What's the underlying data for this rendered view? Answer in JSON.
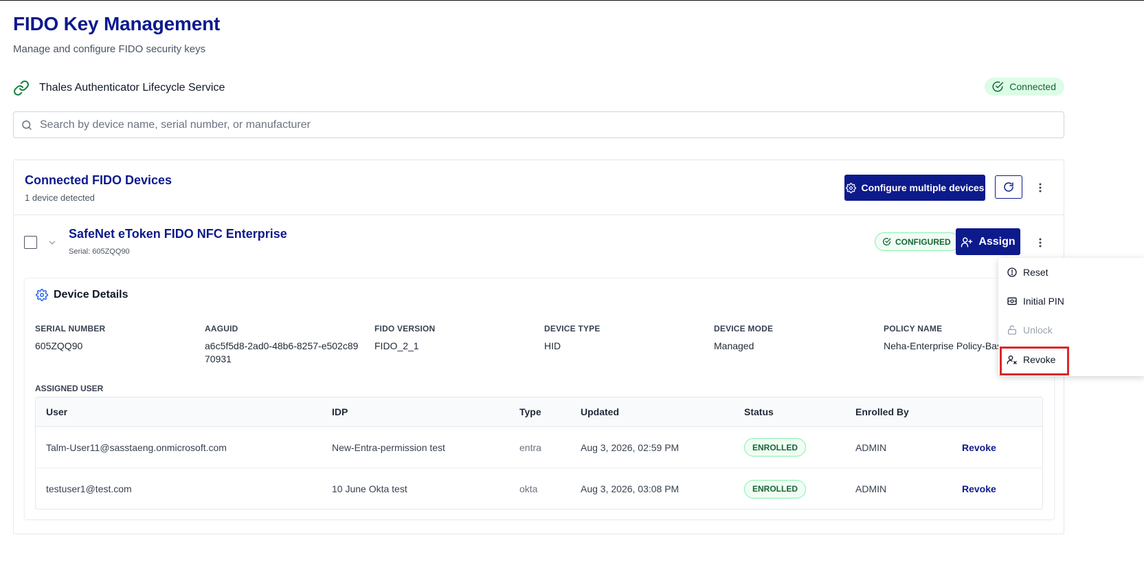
{
  "header": {
    "title": "FIDO Key Management",
    "subtitle": "Manage and configure FIDO security keys"
  },
  "service": {
    "name": "Thales Authenticator Lifecycle Service",
    "status": "Connected"
  },
  "search": {
    "placeholder": "Search by device name, serial number, or manufacturer",
    "value": ""
  },
  "devices_card": {
    "title": "Connected FIDO Devices",
    "count": "1 device detected",
    "configure_label": "Configure multiple devices"
  },
  "device": {
    "name": "SafeNet eToken FIDO NFC Enterprise",
    "serial": "Serial: 605ZQQ90",
    "status": "CONFIGURED",
    "assign_label": "Assign"
  },
  "details": {
    "title": "Device Details",
    "fields": [
      {
        "label": "SERIAL NUMBER",
        "value": "605ZQQ90"
      },
      {
        "label": "AAGUID",
        "value": "a6c5f5d8-2ad0-48b6-8257-e502c8970931"
      },
      {
        "label": "FIDO VERSION",
        "value": "FIDO_2_1"
      },
      {
        "label": "DEVICE TYPE",
        "value": "HID"
      },
      {
        "label": "DEVICE MODE",
        "value": "Managed"
      },
      {
        "label": "POLICY NAME",
        "value": "Neha-Enterprise Policy-Basic"
      }
    ],
    "assigned_label": "ASSIGNED USER"
  },
  "users_table": {
    "columns": [
      "User",
      "IDP",
      "Type",
      "Updated",
      "Status",
      "Enrolled By"
    ],
    "rows": [
      {
        "user": "Talm-User11@sasstaeng.onmicrosoft.com",
        "idp": "New-Entra-permission test",
        "type": "entra",
        "updated": "Aug 3, 2026, 02:59 PM",
        "status": "ENROLLED",
        "enrolled_by": "ADMIN",
        "action": "Revoke"
      },
      {
        "user": "testuser1@test.com",
        "idp": "10 June Okta test",
        "type": "okta",
        "updated": "Aug 3, 2026, 03:08 PM",
        "status": "ENROLLED",
        "enrolled_by": "ADMIN",
        "action": "Revoke"
      }
    ]
  },
  "context_menu": {
    "items": [
      {
        "label": "Reset",
        "icon": "alert-circle-icon",
        "disabled": false
      },
      {
        "label": "Initial PIN",
        "icon": "pin-icon",
        "disabled": false
      },
      {
        "label": "Unlock",
        "icon": "unlock-icon",
        "disabled": true
      },
      {
        "label": "Revoke",
        "icon": "user-x-icon",
        "disabled": false
      }
    ]
  },
  "colors": {
    "brand": "#0d1a8c",
    "success_bg": "#dcfce7",
    "success_text": "#166534",
    "highlight": "#dc2626"
  }
}
